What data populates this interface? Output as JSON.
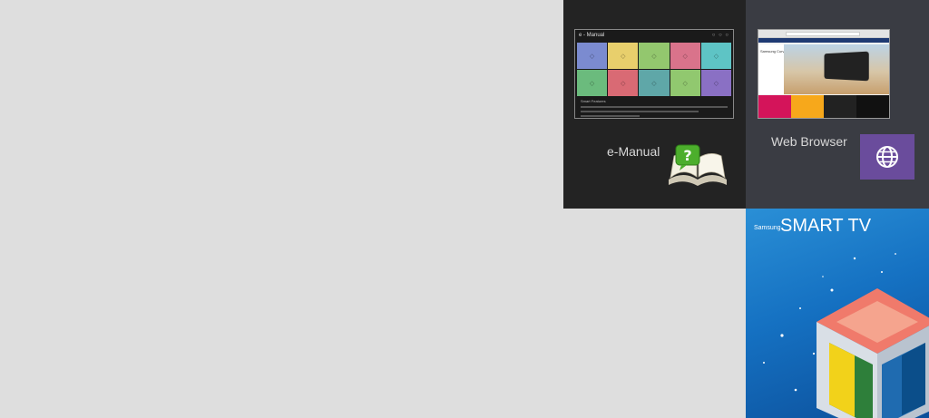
{
  "tiles": {
    "emanual": {
      "label": "e-Manual",
      "thumbnail": {
        "title": "e - Manual",
        "dots": "○ ○ ○",
        "cells": [
          {
            "color": "#7b8bd0"
          },
          {
            "color": "#e8cf6c"
          },
          {
            "color": "#93c76e"
          },
          {
            "color": "#d9738b"
          },
          {
            "color": "#5ec4c5"
          },
          {
            "color": "#6bbb7d"
          },
          {
            "color": "#d96a74"
          },
          {
            "color": "#5fa7a8"
          },
          {
            "color": "#91c86f"
          },
          {
            "color": "#8a70c4"
          }
        ],
        "heading": "Smart Features"
      }
    },
    "webbrowser": {
      "label": "Web Browser",
      "thumbnail": {
        "hero_title": "Samsung Curved UHD TV"
      },
      "icon_color": "#6a4c9c"
    },
    "smarttv": {
      "brand": "Samsung",
      "logo": "SMART TV"
    }
  }
}
